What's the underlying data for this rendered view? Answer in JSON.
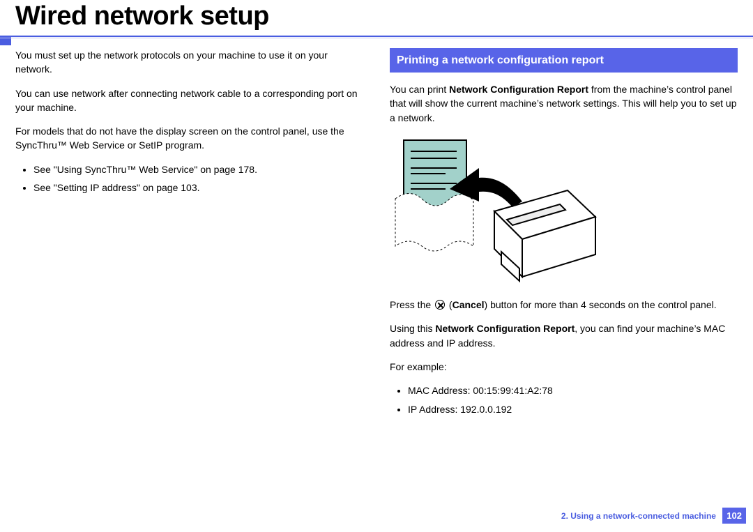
{
  "page_title": "Wired network setup",
  "left": {
    "p1": "You must set up the network protocols on your machine to use it on your network.",
    "p2": "You can use network after connecting network cable to a corresponding port on your machine.",
    "p3": "For models that do not have the display screen on the control panel, use the SyncThru™ Web Service or SetIP program.",
    "bullets": [
      "See \"Using SyncThru™ Web Service\" on page 178.",
      "See \"Setting IP address\" on page 103."
    ]
  },
  "right": {
    "section_heading": "Printing a network configuration report",
    "p1_pre": "You can print ",
    "p1_bold": "Network Configuration Report",
    "p1_post": " from the machine’s control panel that will show the current machine’s network settings. This will help you to set up a network.",
    "press_pre": "Press the ",
    "press_icon_paren_open": " (",
    "press_bold": "Cancel",
    "press_paren_close": ") ",
    "press_post": "button for more than 4 seconds on the control panel.",
    "p3_pre": "Using this ",
    "p3_bold": "Network Configuration Report",
    "p3_post": ", you can find your machine’s MAC address and IP address.",
    "for_example": "For example:",
    "examples": [
      "MAC Address: 00:15:99:41:A2:78",
      "IP Address: 192.0.0.192"
    ]
  },
  "footer": {
    "chapter": "2.  Using a network-connected machine",
    "page_number": "102"
  }
}
